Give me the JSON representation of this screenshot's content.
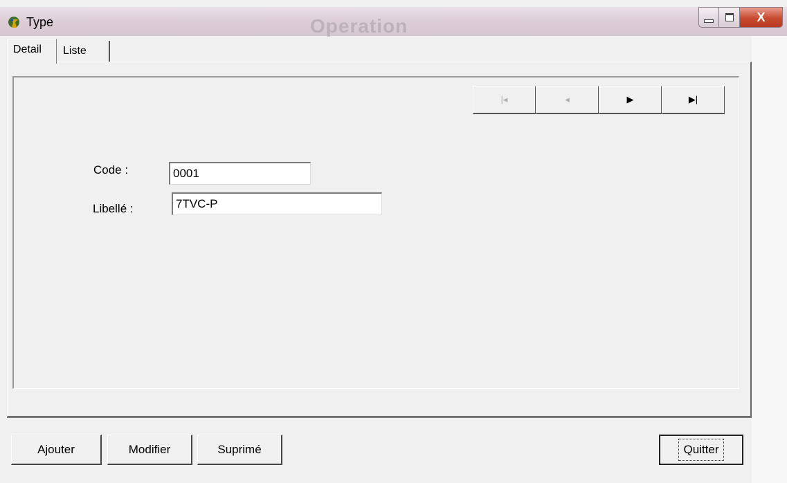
{
  "window": {
    "title": "Type",
    "background_title": "Operation",
    "controls": {
      "minimize": "–",
      "maximize": "□",
      "close": "X"
    }
  },
  "tabs": [
    {
      "label": "Detail",
      "active": true
    },
    {
      "label": "Liste",
      "active": false
    }
  ],
  "navigator": {
    "first": {
      "glyph": "|◂",
      "enabled": false
    },
    "prior": {
      "glyph": "◂",
      "enabled": false
    },
    "next": {
      "glyph": "▶",
      "enabled": true
    },
    "last": {
      "glyph": "▶|",
      "enabled": true
    }
  },
  "form": {
    "code": {
      "label": "Code :",
      "value": "0001"
    },
    "libelle": {
      "label": "Libellé :",
      "value": "7TVC-P"
    }
  },
  "buttons": {
    "ajouter": "Ajouter",
    "modifier": "Modifier",
    "suprime": "Suprimé",
    "quitter": "Quitter"
  },
  "colors": {
    "face": "#f0f0f0",
    "titlebar": "#dccdd6",
    "close": "#c84a31"
  }
}
